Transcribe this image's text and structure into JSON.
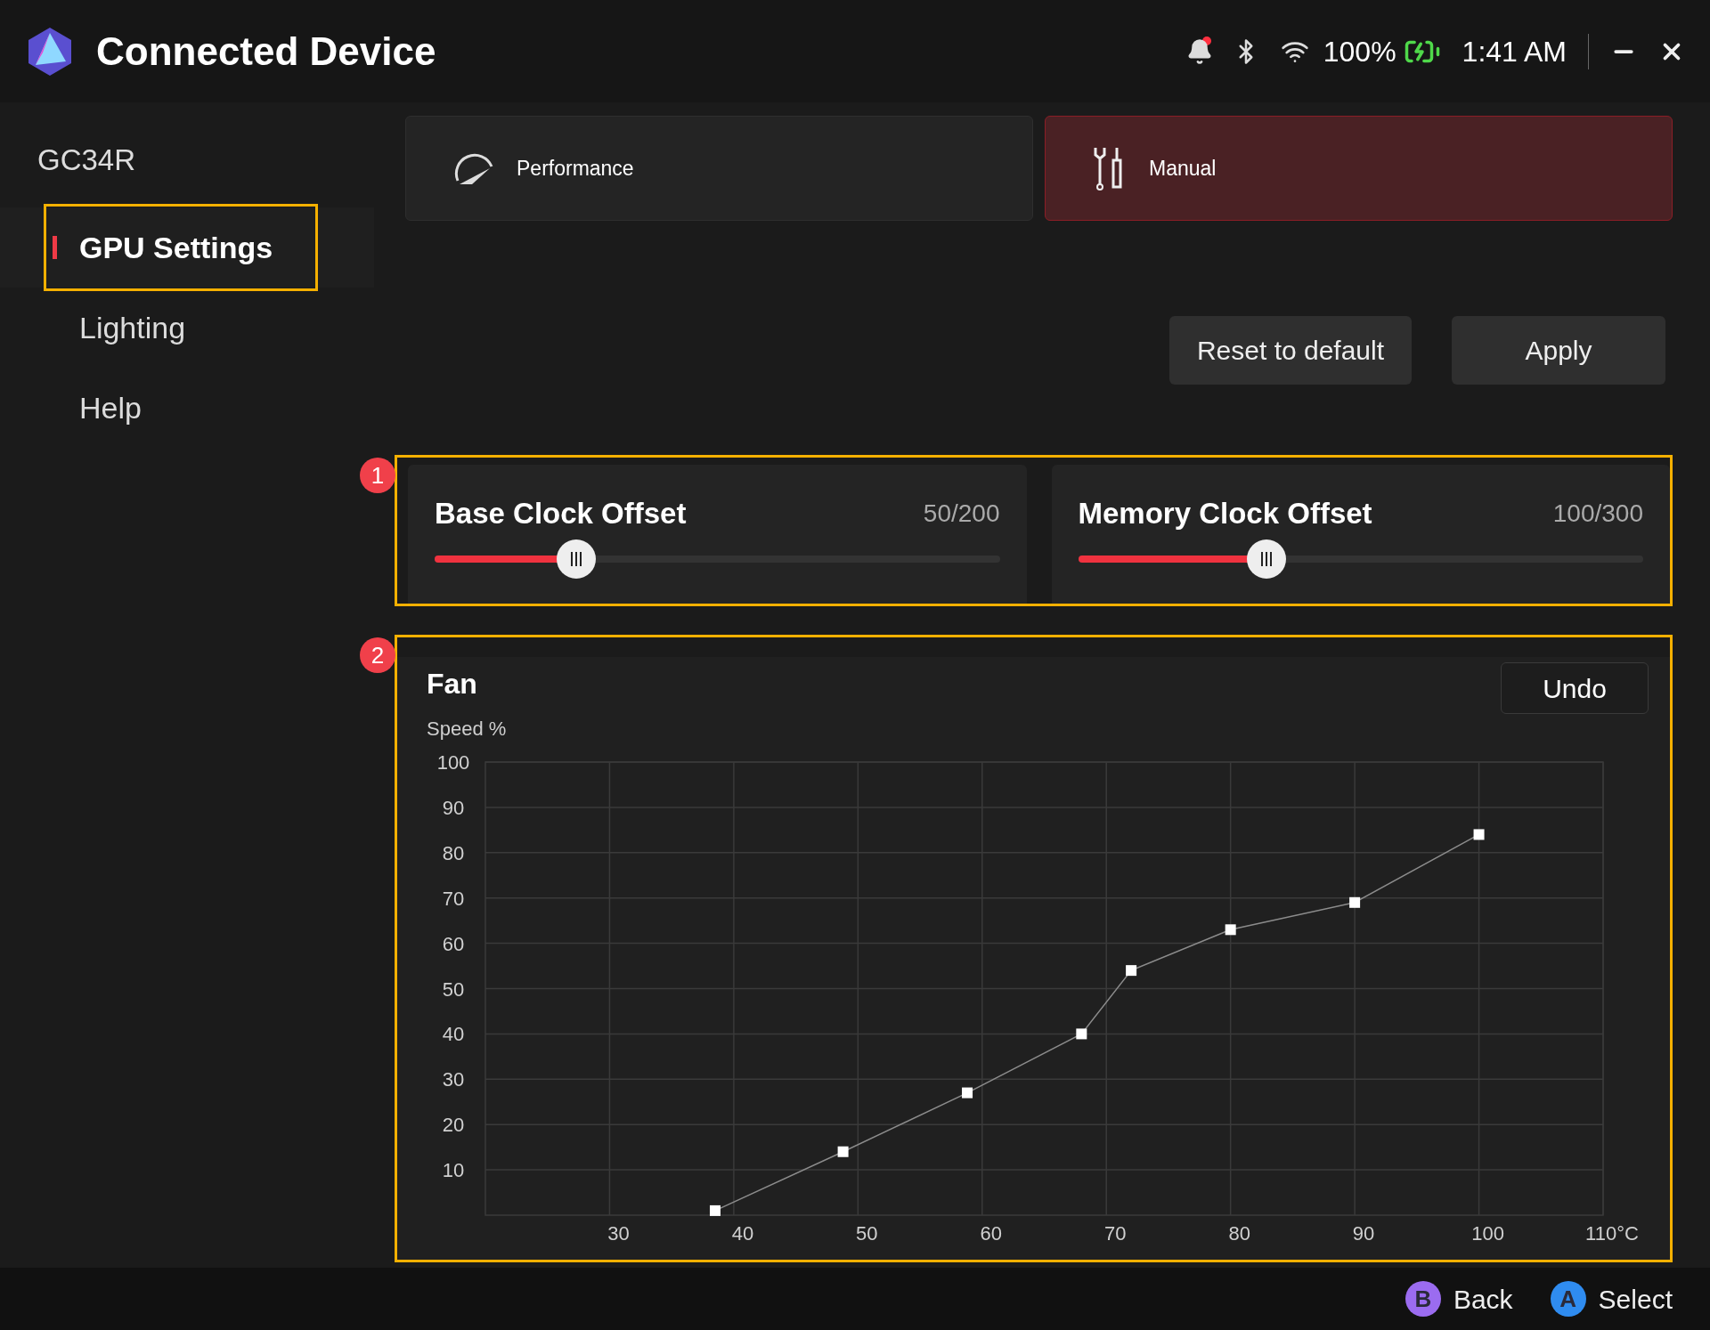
{
  "window": {
    "title": "Connected Device"
  },
  "status_bar": {
    "notification_dot": true,
    "battery": "100%",
    "charging": true,
    "time": "1:41 AM"
  },
  "sidebar": {
    "device": "GC34R",
    "items": [
      {
        "label": "GPU Settings",
        "selected": true,
        "highlighted": true
      },
      {
        "label": "Lighting",
        "selected": false,
        "highlighted": false
      },
      {
        "label": "Help",
        "selected": false,
        "highlighted": false
      }
    ]
  },
  "modes": [
    {
      "kind": "performance",
      "label": "Performance",
      "selected": false
    },
    {
      "kind": "manual",
      "label": "Manual",
      "selected": true
    }
  ],
  "actions": [
    "Reset to default",
    "Apply"
  ],
  "clock_section": {
    "callout": "1",
    "sliders": [
      {
        "label": "Base Clock Offset",
        "reading": "50/200",
        "level": 0.25
      },
      {
        "label": "Memory Clock Offset",
        "reading": "100/300",
        "level": 0.333
      }
    ]
  },
  "fan": {
    "callout": "2",
    "title": "Fan",
    "undo": "Undo",
    "chart_data": {
      "type": "line",
      "ylabel": "Speed %",
      "xlim": [
        20,
        110
      ],
      "ylim": [
        0,
        100
      ],
      "xticks": [
        30,
        40,
        50,
        60,
        70,
        80,
        90,
        100,
        {
          "value": 110,
          "label": "110°C"
        }
      ],
      "yticks": [
        10,
        20,
        30,
        40,
        50,
        60,
        70,
        80,
        90,
        100
      ],
      "x": [
        38.5,
        48.8,
        58.8,
        68,
        72,
        80,
        90,
        100
      ],
      "grid": true,
      "series": [
        {
          "color": "#8c8c8c",
          "marker": "square",
          "values": [
            1,
            14,
            27,
            40,
            54,
            63,
            69,
            84
          ]
        }
      ]
    }
  },
  "footer": [
    {
      "key": "B",
      "label": "Back",
      "color": "#9b6cf0"
    },
    {
      "key": "A",
      "label": "Select",
      "color": "#2f8cf0"
    }
  ]
}
